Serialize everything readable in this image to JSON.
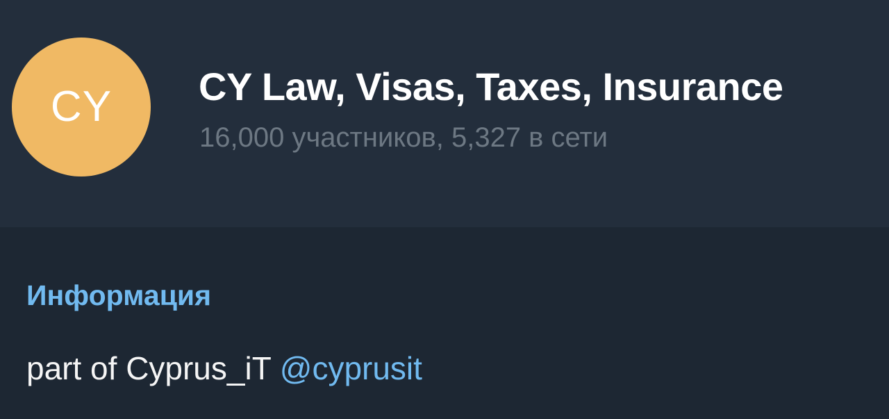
{
  "header": {
    "avatar": {
      "initials": "CY",
      "color": "#f0b964"
    },
    "title": "CY Law, Visas, Taxes, Insurance",
    "subtitle": "16,000 участников, 5,327 в сети"
  },
  "info": {
    "heading": "Информация",
    "description_text": "part of Cyprus_iT ",
    "mention": "@cyprusit"
  },
  "colors": {
    "header_background": "#232e3c",
    "page_background": "#1d2733",
    "accent": "#71baf0",
    "subtitle": "#6d7883"
  }
}
